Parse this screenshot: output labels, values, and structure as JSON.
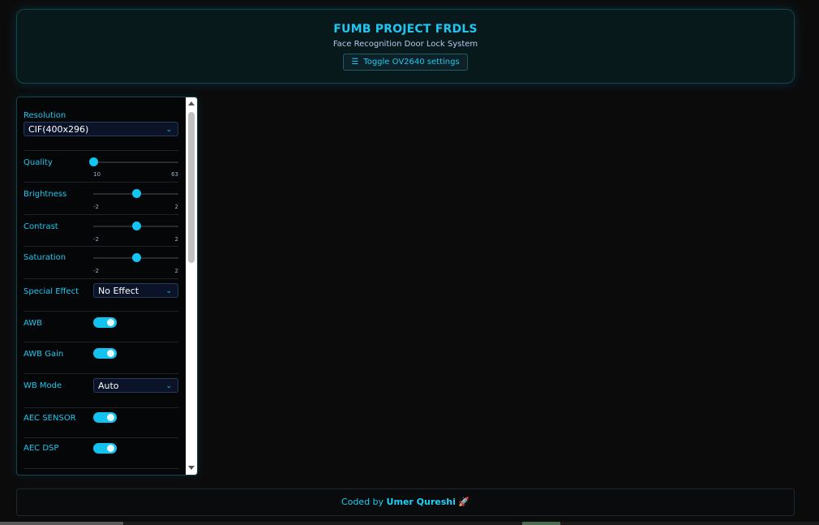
{
  "header": {
    "title": "FUMB PROJECT FRDLS",
    "subtitle": "Face Recognition Door Lock System",
    "toggle_label": "Toggle OV2640 settings"
  },
  "settings": {
    "resolution": {
      "label": "Resolution",
      "value": "CIF(400x296)"
    },
    "quality": {
      "label": "Quality",
      "min": "10",
      "max": "63",
      "value": 10
    },
    "brightness": {
      "label": "Brightness",
      "min": "-2",
      "max": "2",
      "value": 0
    },
    "contrast": {
      "label": "Contrast",
      "min": "-2",
      "max": "2",
      "value": 0
    },
    "saturation": {
      "label": "Saturation",
      "min": "-2",
      "max": "2",
      "value": 0
    },
    "special_effect": {
      "label": "Special Effect",
      "value": "No Effect"
    },
    "awb": {
      "label": "AWB",
      "on": true
    },
    "awb_gain": {
      "label": "AWB Gain",
      "on": true
    },
    "wb_mode": {
      "label": "WB Mode",
      "value": "Auto"
    },
    "aec_sensor": {
      "label": "AEC SENSOR",
      "on": true
    },
    "aec_dsp": {
      "label": "AEC DSP",
      "on": true
    }
  },
  "footer": {
    "prefix": "Coded by",
    "author": "Umer Qureshi",
    "emoji": "🚀"
  },
  "colors": {
    "accent": "#1ec8f0",
    "background": "#0b0b0c",
    "toggle_on": "#14c2ef"
  }
}
